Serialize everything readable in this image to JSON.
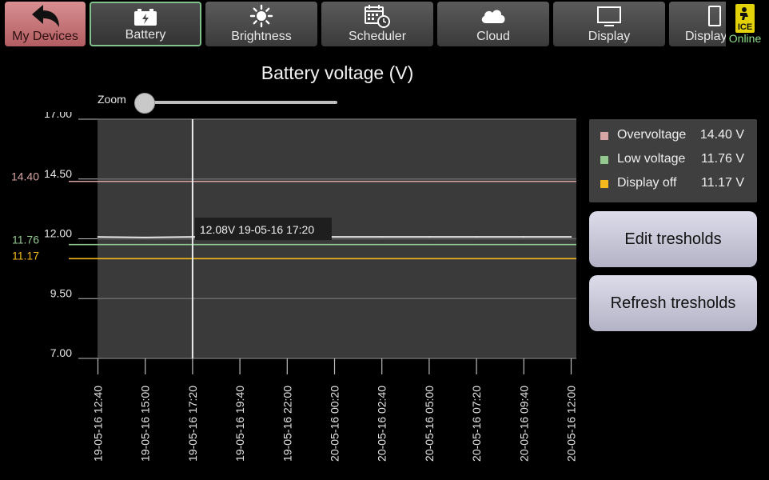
{
  "toolbar": {
    "tabs": [
      {
        "label": "My Devices",
        "icon": "back-arrow-icon"
      },
      {
        "label": "Battery",
        "icon": "battery-icon"
      },
      {
        "label": "Brightness",
        "icon": "sun-icon"
      },
      {
        "label": "Scheduler",
        "icon": "calendar-clock-icon"
      },
      {
        "label": "Cloud",
        "icon": "cloud-icon"
      },
      {
        "label": "Display",
        "icon": "monitor-icon"
      },
      {
        "label": "Display",
        "icon": "phone-icon"
      }
    ],
    "device": {
      "logo_text": "ICE",
      "status": "Online",
      "status_color": "#8ee08a"
    }
  },
  "chart_title": "Battery voltage (V)",
  "zoom": {
    "label": "Zoom",
    "value": 0
  },
  "tooltip": {
    "value": "12.08V",
    "time": "19-05-16 17:20"
  },
  "legend": [
    {
      "name": "Overvoltage",
      "value": "14.40 V",
      "color": "#d8a5a5"
    },
    {
      "name": "Low voltage",
      "value": "11.76 V",
      "color": "#93c98f"
    },
    {
      "name": "Display off",
      "value": "11.17 V",
      "color": "#f2b81c"
    }
  ],
  "buttons": {
    "edit": "Edit tresholds",
    "refresh": "Refresh tresholds"
  },
  "chart_data": {
    "type": "line",
    "title": "Battery voltage (V)",
    "xlabel": "",
    "ylabel": "",
    "ylim": [
      7.0,
      17.0
    ],
    "y_ticks": [
      "17.00",
      "14.50",
      "12.00",
      "9.50",
      "7.00"
    ],
    "y_tick_values": [
      17.0,
      14.5,
      12.0,
      9.5,
      7.0
    ],
    "x_ticks": [
      "19-05-16 12:40",
      "19-05-16 15:00",
      "19-05-16 17:20",
      "19-05-16 19:40",
      "19-05-16 22:00",
      "20-05-16 00:20",
      "20-05-16 02:40",
      "20-05-16 05:00",
      "20-05-16 07:20",
      "20-05-16 09:40",
      "20-05-16 12:00"
    ],
    "series": [
      {
        "values": [
          12.08,
          12.06,
          12.08,
          12.08,
          12.08,
          12.08,
          12.08,
          12.08,
          12.08,
          12.08,
          12.08
        ],
        "color": "#ffffff"
      }
    ],
    "thresholds": [
      {
        "label": "14.40",
        "value": 14.4,
        "color": "#d8a5a5"
      },
      {
        "label": "11.76",
        "value": 11.76,
        "color": "#93c98f"
      },
      {
        "label": "11.17",
        "value": 11.17,
        "color": "#f2b81c"
      }
    ],
    "cursor_index": 2,
    "grid": true,
    "legend": "right"
  }
}
